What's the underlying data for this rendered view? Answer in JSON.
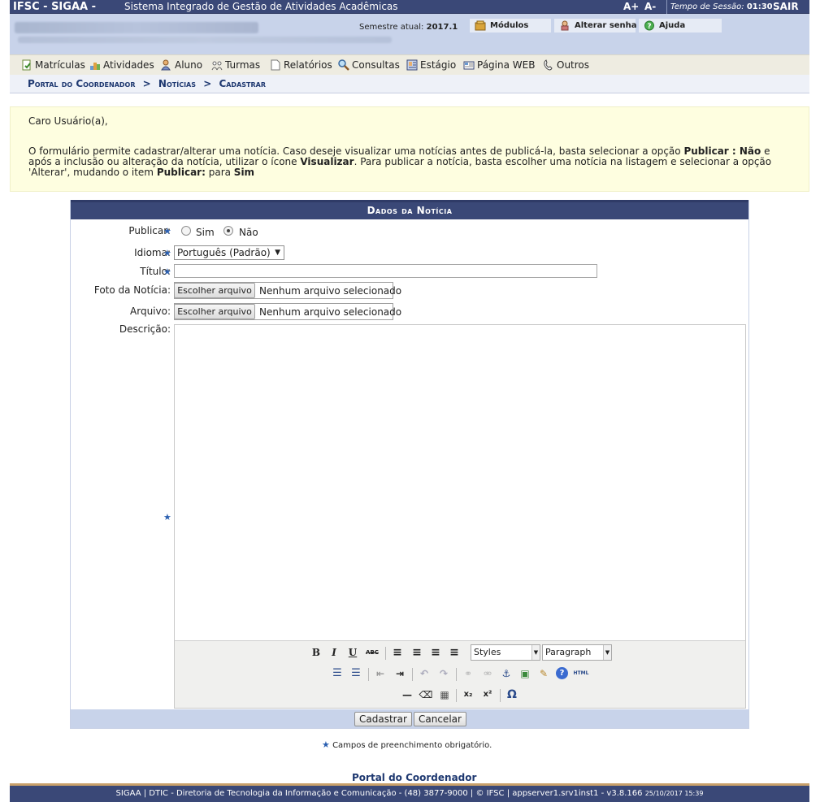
{
  "topbar": {
    "brand": "IFSC - SIGAA -",
    "system_name": "Sistema Integrado de Gestão de Atividades Acadêmicas",
    "font_increase": "A+",
    "font_decrease": "A-",
    "session_label": "Tempo de Sessão:",
    "session_time": "01:30",
    "logout": "SAIR"
  },
  "infobar": {
    "semester_label": "Semestre atual:",
    "semester_value": "2017.1",
    "modules": "Módulos",
    "change_password": "Alterar senha",
    "help": "Ajuda"
  },
  "menu": {
    "items": [
      "Matrículas",
      "Atividades",
      "Aluno",
      "Turmas",
      "Relatórios",
      "Consultas",
      "Estágio",
      "Página WEB",
      "Outros"
    ]
  },
  "breadcrumb": {
    "portal": "Portal do Coordenador",
    "sep": ">",
    "news": "Notícias",
    "register": "Cadastrar"
  },
  "help": {
    "greeting": "Caro Usuário(a),",
    "t1": "O formulário permite cadastrar/alterar uma notícia. Caso deseje visualizar uma notícias antes de publicá-la, basta selecionar a opção ",
    "b1": "Publicar : Não",
    "t2": " e após a inclusão ou alteração da notícia, utilizar o ícone ",
    "b2": "Visualizar",
    "t3": ". Para publicar a notícia, basta escolher uma notícia na listagem e selecionar a opção 'Alterar', mudando o item ",
    "b3": "Publicar:",
    "t4": " para ",
    "b4": "Sim"
  },
  "form": {
    "caption": "Dados da Notícia",
    "publish_label": "Publicar:",
    "yes": "Sim",
    "no": "Não",
    "language_label": "Idioma:",
    "language_value": "Português (Padrão)",
    "language_arrow": "▼",
    "title_label": "Título:",
    "photo_label": "Foto da Notícia:",
    "file_label": "Arquivo:",
    "choose_file": "Escolher arquivo",
    "no_file": "Nenhum arquivo selecionado",
    "description_label": "Descrição:",
    "required_star": "★",
    "submit": "Cadastrar",
    "cancel": "Cancelar"
  },
  "editor": {
    "styles": "Styles",
    "paragraph": "Paragraph",
    "dropdown_arrow": "▼",
    "buttons": {
      "bold": "B",
      "italic": "I",
      "underline": "U",
      "strike": "ABC",
      "align_left": "≡",
      "align_center": "≡",
      "align_right": "≡",
      "justify": "≡",
      "bullets": "☰",
      "numbers": "☰",
      "outdent": "⇤",
      "indent": "⇥",
      "undo": "↶",
      "redo": "↷",
      "link": "⚭",
      "unlink": "⚮",
      "anchor": "⚓",
      "image": "▣",
      "cleanup": "✎",
      "help": "?",
      "html": "HTML",
      "hr": "—",
      "eraser": "⌫",
      "table": "▦",
      "sub": "x₂",
      "sup": "x²",
      "charmap": "Ω"
    }
  },
  "footer": {
    "required_note": "Campos de preenchimento obrigatório.",
    "portal_link": "Portal do Coordenador",
    "text": "SIGAA | DTIC - Diretoria de Tecnologia da Informação e Comunicação - (48) 3877-9000 | © IFSC | appserver1.srv1inst1 - v3.8.166",
    "timestamp": "25/10/2017 15:39"
  },
  "colors": {
    "header_blue": "#3a4877",
    "info_blue": "#c8d3ea",
    "menu_beige": "#eeece1",
    "help_yellow": "#fefee0",
    "link_blue": "#1e3870"
  }
}
